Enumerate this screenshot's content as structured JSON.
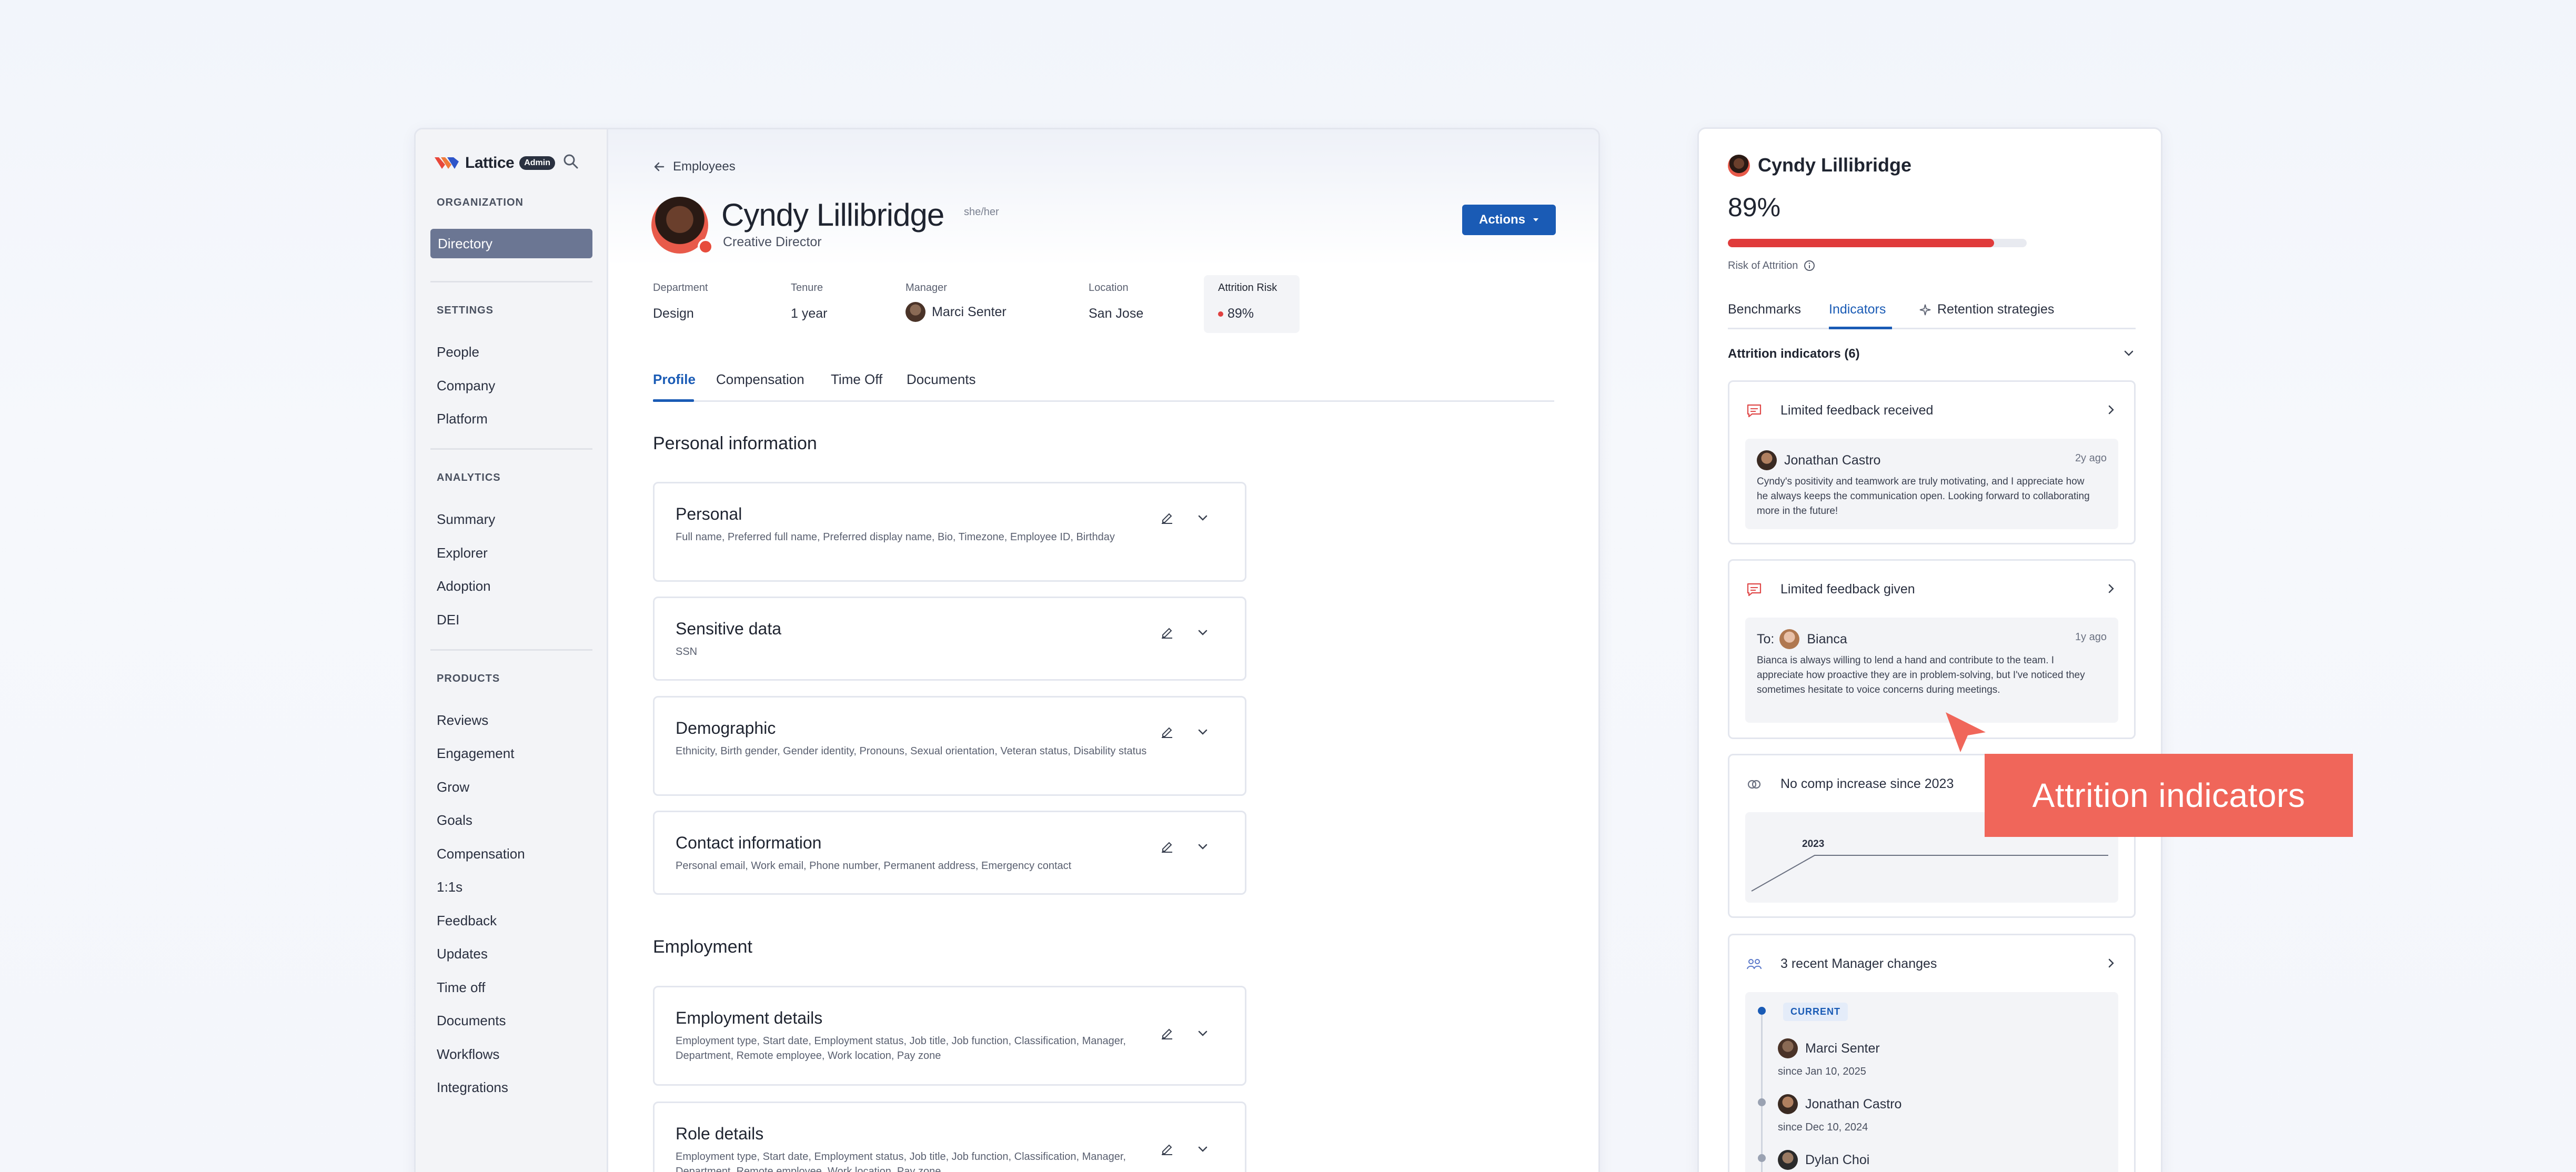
{
  "sidebar": {
    "brand": "Lattice",
    "badge": "Admin",
    "sections": {
      "organization": "ORGANIZATION",
      "settings": "SETTINGS",
      "analytics": "ANALYTICS",
      "products": "PRODUCTS"
    },
    "directory": "Directory",
    "settings_items": [
      "People",
      "Company",
      "Platform"
    ],
    "analytics_items": [
      "Summary",
      "Explorer",
      "Adoption",
      "DEI"
    ],
    "product_items": [
      "Reviews",
      "Engagement",
      "Grow",
      "Goals",
      "Compensation",
      "1:1s",
      "Feedback",
      "Updates",
      "Time off",
      "Documents",
      "Workflows",
      "Integrations"
    ]
  },
  "header": {
    "back": "Employees",
    "name": "Cyndy Lillibridge",
    "pronouns": "she/her",
    "role": "Creative Director",
    "actions": "Actions"
  },
  "meta": {
    "department": {
      "label": "Department",
      "value": "Design"
    },
    "tenure": {
      "label": "Tenure",
      "value": "1 year"
    },
    "manager": {
      "label": "Manager",
      "value": "Marci Senter"
    },
    "location": {
      "label": "Location",
      "value": "San Jose"
    },
    "risk": {
      "label": "Attrition Risk",
      "value": "89%"
    }
  },
  "tabs": [
    "Profile",
    "Compensation",
    "Time Off",
    "Documents"
  ],
  "personal": {
    "title": "Personal information",
    "cards": [
      {
        "title": "Personal",
        "sub": "Full name, Preferred full name, Preferred display name, Bio, Timezone, Employee ID, Birthday"
      },
      {
        "title": "Sensitive data",
        "sub": "SSN"
      },
      {
        "title": "Demographic",
        "sub": "Ethnicity, Birth gender, Gender identity, Pronouns, Sexual orientation, Veteran status, Disability status"
      },
      {
        "title": "Contact information",
        "sub": "Personal email, Work email, Phone number, Permanent address, Emergency contact"
      }
    ]
  },
  "employment": {
    "title": "Employment",
    "cards": [
      {
        "title": "Employment details",
        "sub": "Employment type, Start date, Employment status, Job title, Job function, Classification, Manager, Department, Remote employee, Work location, Pay zone"
      },
      {
        "title": "Role details",
        "sub": "Employment type, Start date, Employment status, Job title, Job function, Classification, Manager, Department, Remote employee, Work location, Pay zone"
      }
    ]
  },
  "panel": {
    "name": "Cyndy Lillibridge",
    "percent": "89%",
    "risk_fraction": 0.89,
    "risk_label": "Risk of Attrition",
    "tabs": [
      "Benchmarks",
      "Indicators",
      "Retention strategies"
    ],
    "section": "Attrition indicators (6)",
    "indicators": {
      "feedback_received": {
        "title": "Limited feedback received",
        "who": "Jonathan Castro",
        "time": "2y ago",
        "text": "Cyndy's positivity and teamwork are truly motivating, and I appreciate how he always keeps the communication open. Looking forward to collaborating more in the future!"
      },
      "feedback_given": {
        "title": "Limited feedback given",
        "to_label": "To:",
        "who": "Bianca",
        "time": "1y ago",
        "text": "Bianca is always willing to lend a hand and contribute to the team. I appreciate how proactive they are in problem-solving, but I've noticed they sometimes hesitate to voice concerns during meetings."
      },
      "comp": {
        "title": "No comp increase since 2023",
        "year_label": "2023"
      },
      "managers": {
        "title": "3 recent Manager changes",
        "current": "CURRENT",
        "list": [
          {
            "name": "Marci Senter",
            "since": "since Jan 10, 2025"
          },
          {
            "name": "Jonathan Castro",
            "since": "since Dec 10, 2024"
          },
          {
            "name": "Dylan Choi",
            "since": ""
          }
        ]
      }
    }
  },
  "callout": "Attrition indicators",
  "colors": {
    "accent": "#1a5bb5",
    "risk": "#e03b3b",
    "callout": "#f0665a"
  }
}
